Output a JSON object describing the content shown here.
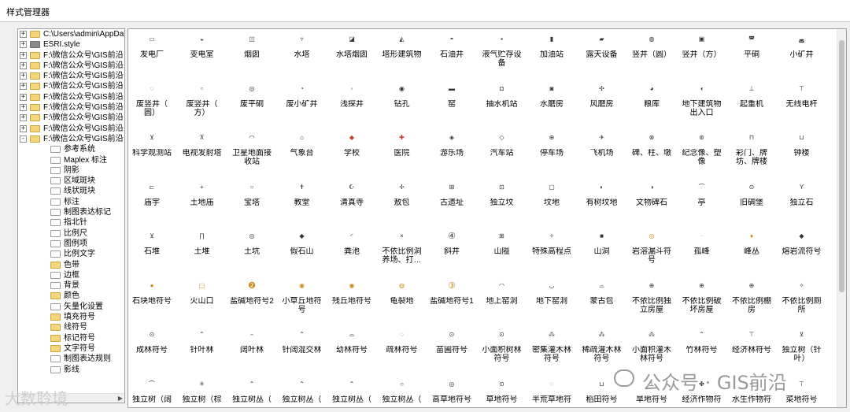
{
  "window": {
    "title": "样式管理器"
  },
  "tree": {
    "items": [
      {
        "label": "C:\\Users\\admin\\AppData",
        "level": 0,
        "expander": "+",
        "folder": "yellow"
      },
      {
        "label": "ESRI.style",
        "level": 0,
        "expander": "+",
        "folder": "grey"
      },
      {
        "label": "F:\\微信公众号\\GIS前沿",
        "level": 0,
        "expander": "+",
        "folder": "yellow"
      },
      {
        "label": "F:\\微信公众号\\GIS前沿",
        "level": 0,
        "expander": "+",
        "folder": "yellow"
      },
      {
        "label": "F:\\微信公众号\\GIS前沿",
        "level": 0,
        "expander": "+",
        "folder": "yellow"
      },
      {
        "label": "F:\\微信公众号\\GIS前沿",
        "level": 0,
        "expander": "+",
        "folder": "yellow"
      },
      {
        "label": "F:\\微信公众号\\GIS前沿",
        "level": 0,
        "expander": "+",
        "folder": "yellow"
      },
      {
        "label": "F:\\微信公众号\\GIS前沿",
        "level": 0,
        "expander": "+",
        "folder": "yellow"
      },
      {
        "label": "F:\\微信公众号\\GIS前沿",
        "level": 0,
        "expander": "+",
        "folder": "yellow"
      },
      {
        "label": "F:\\微信公众号\\GIS前沿",
        "level": 0,
        "expander": "+",
        "folder": "yellow"
      },
      {
        "label": "F:\\微信公众号\\GIS前沿",
        "level": 0,
        "expander": "-",
        "folder": "yellow"
      },
      {
        "label": "参考系统",
        "level": 1,
        "folder": "open"
      },
      {
        "label": "Maplex 标注",
        "level": 1,
        "folder": "open"
      },
      {
        "label": "阴影",
        "level": 1,
        "folder": "open"
      },
      {
        "label": "区域斑块",
        "level": 1,
        "folder": "open"
      },
      {
        "label": "线状斑块",
        "level": 1,
        "folder": "open"
      },
      {
        "label": "标注",
        "level": 1,
        "folder": "open"
      },
      {
        "label": "制图表达标记",
        "level": 1,
        "folder": "open"
      },
      {
        "label": "指北针",
        "level": 1,
        "folder": "open"
      },
      {
        "label": "比例尺",
        "level": 1,
        "folder": "open"
      },
      {
        "label": "图例项",
        "level": 1,
        "folder": "open"
      },
      {
        "label": "比例文字",
        "level": 1,
        "folder": "open"
      },
      {
        "label": "色带",
        "level": 1,
        "folder": "yellow"
      },
      {
        "label": "边框",
        "level": 1,
        "folder": "open"
      },
      {
        "label": "背景",
        "level": 1,
        "folder": "open"
      },
      {
        "label": "颜色",
        "level": 1,
        "folder": "yellow"
      },
      {
        "label": "矢量化设置",
        "level": 1,
        "folder": "open"
      },
      {
        "label": "填充符号",
        "level": 1,
        "folder": "yellow"
      },
      {
        "label": "线符号",
        "level": 1,
        "folder": "yellow"
      },
      {
        "label": "标记符号",
        "level": 1,
        "folder": "yellow"
      },
      {
        "label": "文字符号",
        "level": 1,
        "folder": "yellow"
      },
      {
        "label": "制图表达规则",
        "level": 1,
        "folder": "open"
      },
      {
        "label": "影线",
        "level": 1,
        "folder": "open"
      }
    ]
  },
  "symbols": [
    {
      "label": "发电厂",
      "icon": "▭"
    },
    {
      "label": "变电室",
      "icon": "◒"
    },
    {
      "label": "烟囱",
      "icon": "◫"
    },
    {
      "label": "水塔",
      "icon": "▿"
    },
    {
      "label": "水塔烟囱",
      "icon": "◪"
    },
    {
      "label": "塔形建筑物",
      "icon": "◭"
    },
    {
      "label": "石油井",
      "icon": "◓"
    },
    {
      "label": "液气贮存设\n备",
      "icon": "▪"
    },
    {
      "label": "加油站",
      "icon": "▮"
    },
    {
      "label": "露天设备",
      "icon": "▰"
    },
    {
      "label": "竖井（圆）",
      "icon": "◍"
    },
    {
      "label": "竖井（方）",
      "icon": "▣"
    },
    {
      "label": "平硐",
      "icon": "◚"
    },
    {
      "label": "小矿井",
      "icon": "◛"
    },
    {
      "label": "废竖井（\n圆）",
      "icon": "◌"
    },
    {
      "label": "废竖井（\n方）",
      "icon": "▫"
    },
    {
      "label": "废平硐",
      "icon": "◎"
    },
    {
      "label": "废小矿井",
      "icon": "◔"
    },
    {
      "label": "浅探井",
      "icon": "◦"
    },
    {
      "label": "钻孔",
      "icon": "◉"
    },
    {
      "label": "窑",
      "icon": "▬"
    },
    {
      "label": "抽水机站",
      "icon": "◘"
    },
    {
      "label": "水磨房",
      "icon": "◙"
    },
    {
      "label": "风磨房",
      "icon": "✣"
    },
    {
      "label": "粮库",
      "icon": "◕"
    },
    {
      "label": "地下建筑物\n出入口",
      "icon": "◖"
    },
    {
      "label": "起重机",
      "icon": "⊥"
    },
    {
      "label": "无线电杆",
      "icon": "⊤"
    },
    {
      "label": "科学观测站",
      "icon": "⊻"
    },
    {
      "label": "电视发射塔",
      "icon": "⊼"
    },
    {
      "label": "卫星地面接\n收站",
      "icon": "◠"
    },
    {
      "label": "气象台",
      "icon": "⌂"
    },
    {
      "label": "学校",
      "icon": "◆",
      "color": "red"
    },
    {
      "label": "医院",
      "icon": "✚",
      "color": "red"
    },
    {
      "label": "游乐场",
      "icon": "◈"
    },
    {
      "label": "汽车站",
      "icon": "◇"
    },
    {
      "label": "停车场",
      "icon": "⊕"
    },
    {
      "label": "飞机场",
      "icon": "✈"
    },
    {
      "label": "碑、柱、墩",
      "icon": "⊗"
    },
    {
      "label": "纪念像、塑\n像",
      "icon": "⊛"
    },
    {
      "label": "彩门、牌\n坊、牌楼",
      "icon": "⊓"
    },
    {
      "label": "钟楼",
      "icon": "⊔"
    },
    {
      "label": "庙宇",
      "icon": "⊏"
    },
    {
      "label": "土地庙",
      "icon": "+"
    },
    {
      "label": "宝塔",
      "icon": "○"
    },
    {
      "label": "教堂",
      "icon": "✝"
    },
    {
      "label": "清真寺",
      "icon": "☪"
    },
    {
      "label": "敖包",
      "icon": "✢"
    },
    {
      "label": "古遗址",
      "icon": "⊞"
    },
    {
      "label": "独立坟",
      "icon": "⊡"
    },
    {
      "label": "坟地",
      "icon": "▢"
    },
    {
      "label": "有树坟地",
      "icon": "◐"
    },
    {
      "label": "文物碑石",
      "icon": "◑"
    },
    {
      "label": "亭",
      "icon": "⌒"
    },
    {
      "label": "旧碉堡",
      "icon": "⊙"
    },
    {
      "label": "独立石",
      "icon": "Y"
    },
    {
      "label": "石堆",
      "icon": "⊻"
    },
    {
      "label": "土堆",
      "icon": "∏"
    },
    {
      "label": "土坑",
      "icon": "◎"
    },
    {
      "label": "假石山",
      "icon": "◆"
    },
    {
      "label": "粪池",
      "icon": "◜"
    },
    {
      "label": "不依比例洞\n养场、打…",
      "icon": "×"
    },
    {
      "label": "斜井",
      "icon": "④",
      "size": "big"
    },
    {
      "label": "山隘",
      "icon": "⊞"
    },
    {
      "label": "特殊高程点",
      "icon": "✧"
    },
    {
      "label": "山洞",
      "icon": "■"
    },
    {
      "label": "岩溶漏斗符\n号",
      "icon": "◎",
      "color": "orange"
    },
    {
      "label": "孤峰",
      "icon": "·",
      "color": "orange"
    },
    {
      "label": "峰丛",
      "icon": "♦",
      "color": "orange"
    },
    {
      "label": "熔岩流符号",
      "icon": "◆"
    },
    {
      "label": "石块地符号",
      "icon": "●",
      "color": "orange"
    },
    {
      "label": "火山口",
      "icon": "▢",
      "color": "orange"
    },
    {
      "label": "盐碱地符号2",
      "icon": "❷",
      "color": "orange",
      "size": "big"
    },
    {
      "label": "小草丘地符\n号",
      "icon": "◉",
      "color": "orange"
    },
    {
      "label": "残丘地符号",
      "icon": "◉",
      "color": "orange"
    },
    {
      "label": "龟裂地",
      "icon": "◍",
      "color": "orange"
    },
    {
      "label": "盐碱地符号1",
      "icon": "③",
      "color": "orange",
      "size": "big"
    },
    {
      "label": "地上窑洞",
      "icon": "◠"
    },
    {
      "label": "地下窑洞",
      "icon": "◡"
    },
    {
      "label": "蒙古包",
      "icon": "⌓"
    },
    {
      "label": "不依比例独\n立房屋",
      "icon": "⊕"
    },
    {
      "label": "不依比例破\n坏房屋",
      "icon": "⊕"
    },
    {
      "label": "不依比例棚\n房",
      "icon": "⊕"
    },
    {
      "label": "不依比例厕\n所",
      "icon": "✧"
    },
    {
      "label": "成林符号",
      "icon": "⊙"
    },
    {
      "label": "针叶林",
      "icon": "⌃"
    },
    {
      "label": "阔叶林",
      "icon": "⌢"
    },
    {
      "label": "针阔混交林",
      "icon": "⌃"
    },
    {
      "label": "幼林符号",
      "icon": "⌓"
    },
    {
      "label": "疏林符号",
      "icon": "◌"
    },
    {
      "label": "苗圃符号",
      "icon": "⊙"
    },
    {
      "label": "小面积树林\n符号",
      "icon": "⊙"
    },
    {
      "label": "密集灌木林\n符号",
      "icon": "⁂"
    },
    {
      "label": "稀疏灌木林\n符号",
      "icon": "⁂"
    },
    {
      "label": "小面积灌木\n林符号",
      "icon": "⁂"
    },
    {
      "label": "竹林符号",
      "icon": "⌃"
    },
    {
      "label": "经济林符号",
      "icon": "⊤"
    },
    {
      "label": "独立树（针\n叶）",
      "icon": "⊻"
    },
    {
      "label": "独立树（阔",
      "icon": "⌒"
    },
    {
      "label": "独立树（棕",
      "icon": "✳"
    },
    {
      "label": "独立树丛（",
      "icon": "⌃"
    },
    {
      "label": "独立树丛（",
      "icon": "⌃"
    },
    {
      "label": "独立树丛（",
      "icon": "⌃"
    },
    {
      "label": "独立树丛（",
      "icon": "○"
    },
    {
      "label": "高草地符号",
      "icon": "◎"
    },
    {
      "label": "草地符号",
      "icon": "⊙"
    },
    {
      "label": "半荒草地符",
      "icon": "◌"
    },
    {
      "label": "稻田符号",
      "icon": "⊔"
    },
    {
      "label": "旱地符号",
      "icon": "⊥"
    },
    {
      "label": "经济作物符",
      "icon": "✤"
    },
    {
      "label": "水生作物符",
      "icon": "≈"
    },
    {
      "label": "菜地符号",
      "icon": "⊤"
    }
  ],
  "watermark": {
    "text": "公众号 · GIS前沿",
    "left_text": "大数聆境"
  },
  "colors": {
    "orange": "#c98a1c",
    "red": "#c83a2a",
    "folder": "#f5d67a"
  }
}
